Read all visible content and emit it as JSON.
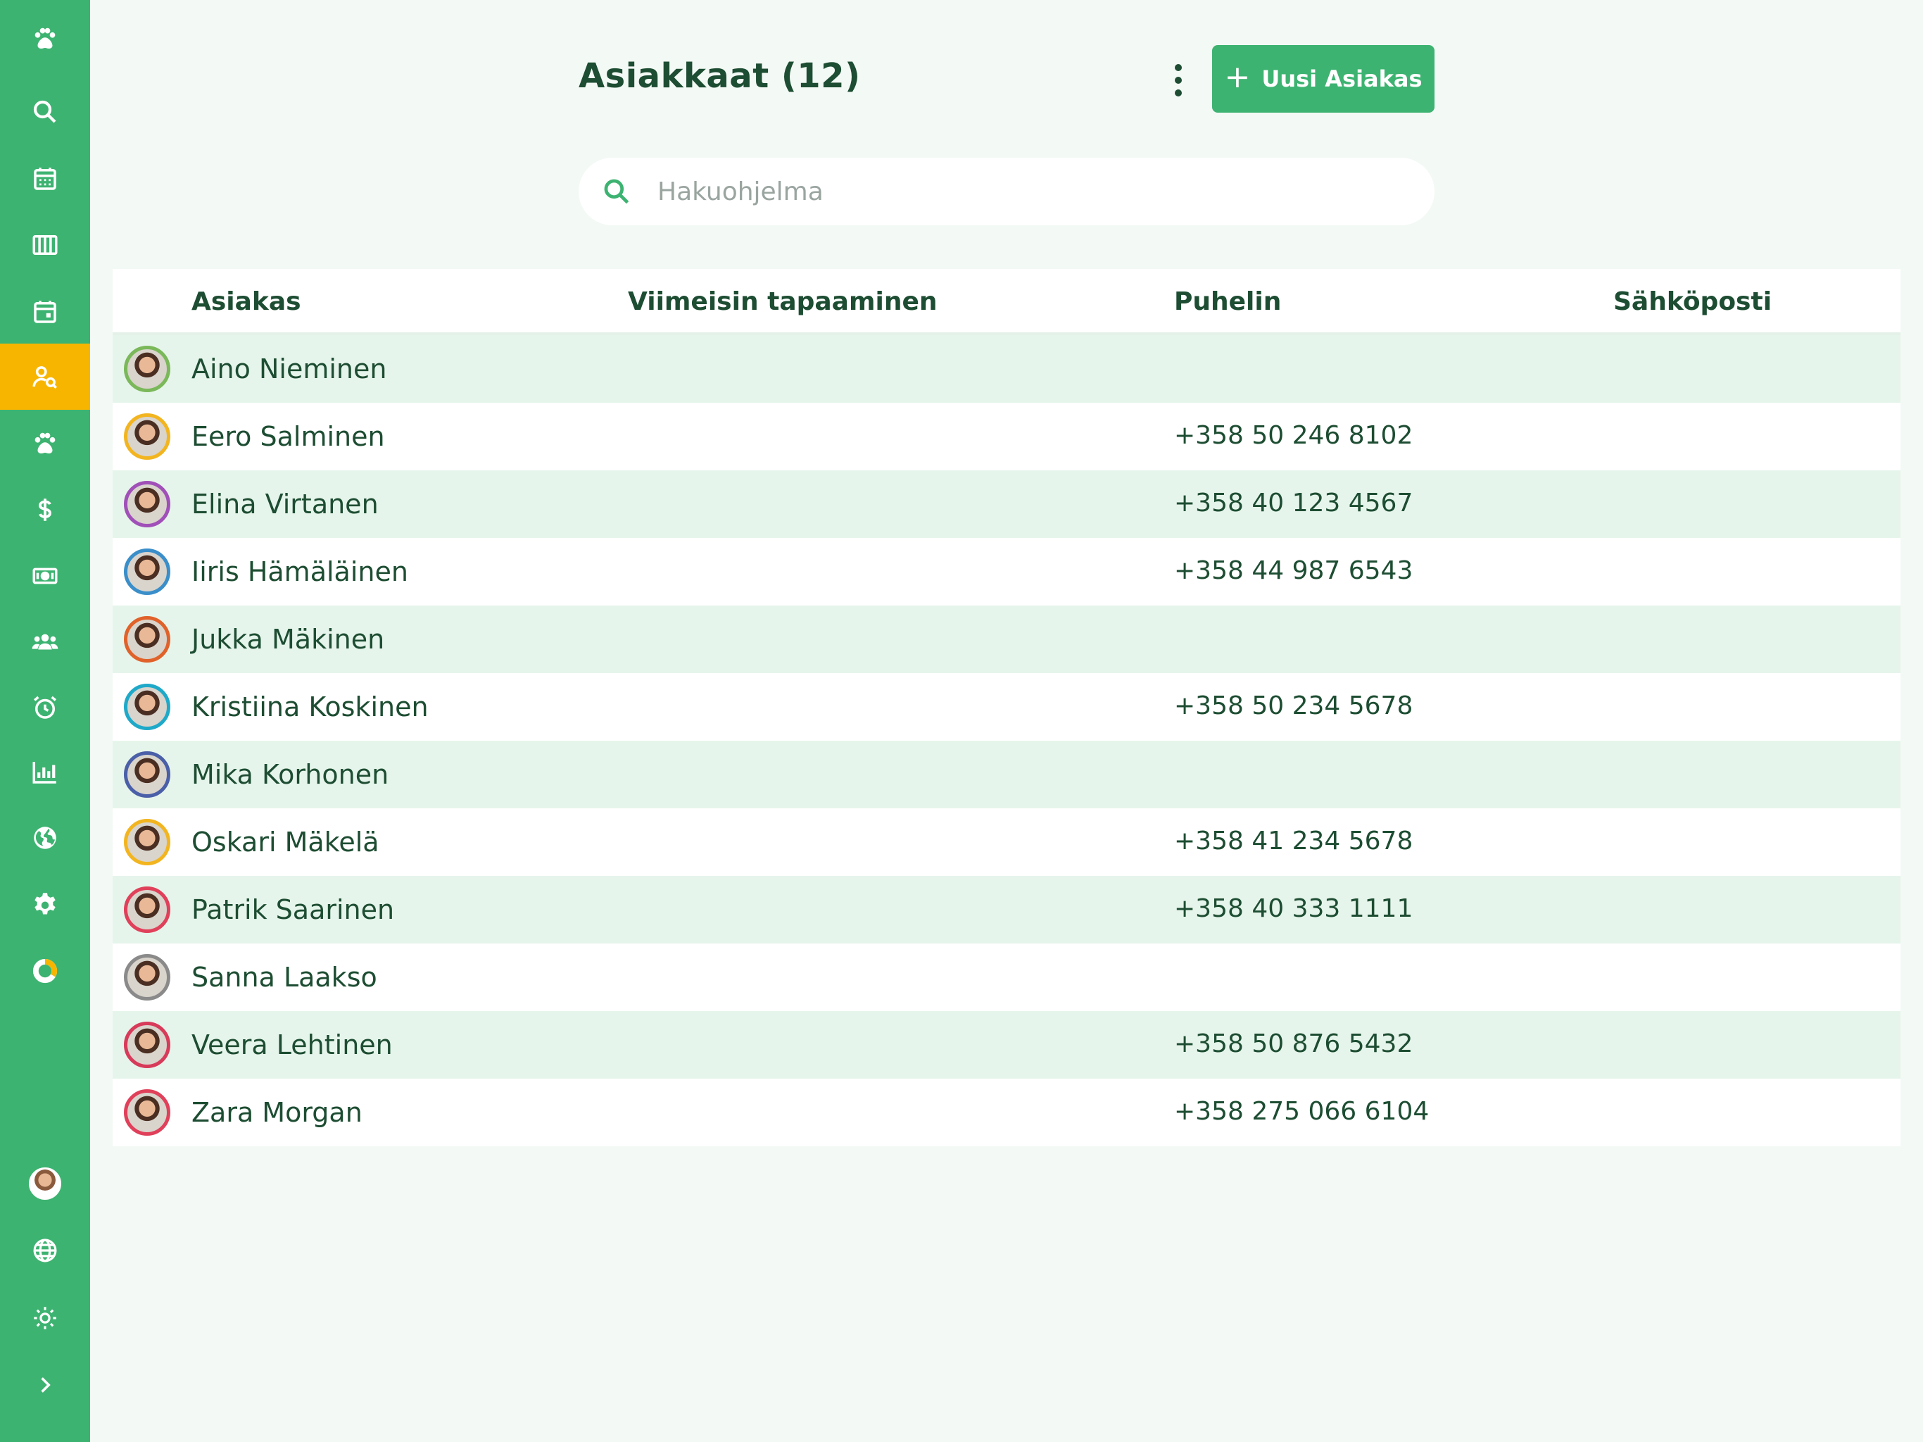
{
  "header": {
    "title": "Asiakkaat (12)",
    "new_button_label": "Uusi Asiakas"
  },
  "search": {
    "placeholder": "Hakuohjelma",
    "value": ""
  },
  "sidebar": {
    "accent_color": "#3db371",
    "active_color": "#f7b500",
    "items": [
      {
        "icon": "paw-icon"
      },
      {
        "icon": "search-icon"
      },
      {
        "icon": "calendar-icon"
      },
      {
        "icon": "columns-icon"
      },
      {
        "icon": "calendar-day-icon"
      },
      {
        "icon": "customer-search-icon",
        "active": true
      },
      {
        "icon": "paw-icon"
      },
      {
        "icon": "dollar-icon"
      },
      {
        "icon": "money-icon"
      },
      {
        "icon": "users-icon"
      },
      {
        "icon": "alarm-clock-icon"
      },
      {
        "icon": "bar-chart-icon"
      },
      {
        "icon": "globe-icon"
      },
      {
        "icon": "gear-icon"
      },
      {
        "icon": "progress-ring-icon"
      }
    ],
    "bottom_items": [
      {
        "icon": "user-avatar"
      },
      {
        "icon": "language-globe-icon"
      },
      {
        "icon": "sun-icon"
      },
      {
        "icon": "chevron-right-icon"
      }
    ]
  },
  "table": {
    "columns": [
      "Asiakas",
      "Viimeisin tapaaminen",
      "Puhelin",
      "Sähköposti"
    ],
    "rows": [
      {
        "name": "Aino Nieminen",
        "last_meeting": "",
        "phone": "",
        "email": "",
        "ring": "#7ab85a"
      },
      {
        "name": "Eero Salminen",
        "last_meeting": "",
        "phone": "+358 50 246 8102",
        "email": "",
        "ring": "#f2b520"
      },
      {
        "name": "Elina Virtanen",
        "last_meeting": "",
        "phone": "+358 40 123 4567",
        "email": "",
        "ring": "#a050b8"
      },
      {
        "name": "Iiris Hämäläinen",
        "last_meeting": "",
        "phone": "+358 44 987 6543",
        "email": "",
        "ring": "#3a8ec9"
      },
      {
        "name": "Jukka Mäkinen",
        "last_meeting": "",
        "phone": "",
        "email": "",
        "ring": "#e0622a"
      },
      {
        "name": "Kristiina Koskinen",
        "last_meeting": "",
        "phone": "+358 50 234 5678",
        "email": "",
        "ring": "#1fa9c9"
      },
      {
        "name": "Mika Korhonen",
        "last_meeting": "",
        "phone": "",
        "email": "",
        "ring": "#4a5fa8"
      },
      {
        "name": "Oskari Mäkelä",
        "last_meeting": "",
        "phone": "+358 41 234 5678",
        "email": "",
        "ring": "#f2b520"
      },
      {
        "name": "Patrik Saarinen",
        "last_meeting": "",
        "phone": "+358 40 333 1111",
        "email": "",
        "ring": "#e0405a"
      },
      {
        "name": "Sanna Laakso",
        "last_meeting": "",
        "phone": "",
        "email": "",
        "ring": "#8a8a8a"
      },
      {
        "name": "Veera Lehtinen",
        "last_meeting": "",
        "phone": "+358 50 876 5432",
        "email": "",
        "ring": "#d83a5a"
      },
      {
        "name": "Zara Morgan",
        "last_meeting": "",
        "phone": "+358 275 066 6104",
        "email": "",
        "ring": "#e0405a"
      }
    ]
  }
}
